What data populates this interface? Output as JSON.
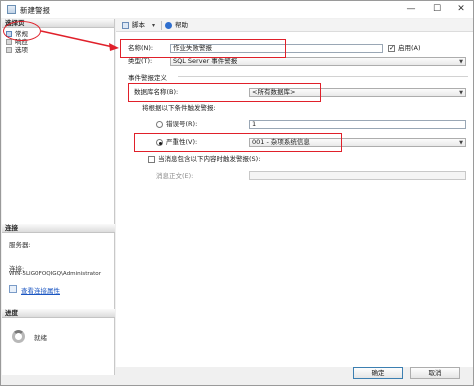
{
  "window": {
    "title": "新建警报",
    "min": "—",
    "max": "☐",
    "close": "✕"
  },
  "left": {
    "select_page_header": "选择页",
    "pages": [
      {
        "label": "常规"
      },
      {
        "label": "响应"
      },
      {
        "label": "选项"
      }
    ],
    "connection_header": "连接",
    "server_label": "服务器:",
    "connection_label": "连接:",
    "connection_value": "WIN-5LIG0FOQIGQ\\Administrator",
    "view_link": "查看连接属性",
    "progress_header": "进度",
    "progress_status": "就绪"
  },
  "toolbar": {
    "script_label": "脚本",
    "help_label": "帮助",
    "caret": "▾"
  },
  "form": {
    "name_label": "名称(N):",
    "name_value": "作业失败警报",
    "enable_label": "启用(A)",
    "enable_checked": true,
    "type_label": "类型(T):",
    "type_value": "SQL Server 事件警报",
    "definition_header": "事件警报定义",
    "database_label": "数据库名称(B):",
    "database_value": "<所有数据库>",
    "raise_label": "将根据以下条件触发警报:",
    "error_number_label": "错误号(R):",
    "error_number_value": "1",
    "severity_label": "严重性(V):",
    "severity_value": "001 - 杂项系统信息",
    "message_check_label": "当消息包含以下内容时触发警报(S):",
    "message_text_label": "消息正文(E):",
    "message_text_value": ""
  },
  "buttons": {
    "ok": "确定",
    "cancel": "取消"
  },
  "colors": {
    "annotation": "#e0202a",
    "link": "#1b56c2"
  }
}
